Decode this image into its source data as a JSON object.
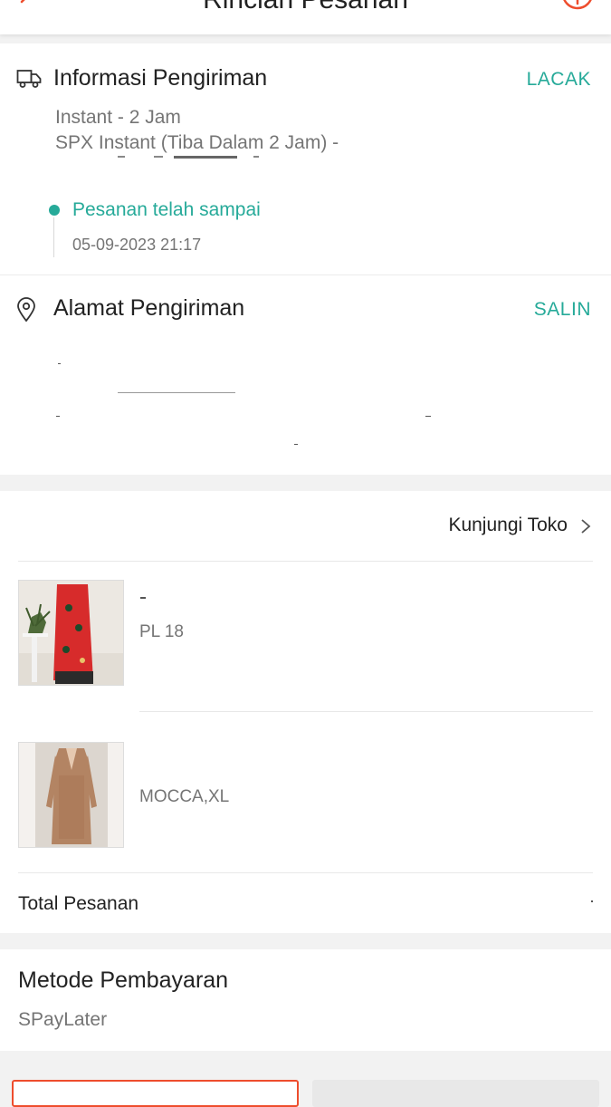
{
  "header": {
    "title": "Rincian Pesanan",
    "back_icon": "arrow-left-icon",
    "help_icon": "help-circle-icon",
    "accent_color": "#ee4d2d"
  },
  "shipping_info": {
    "icon": "truck-icon",
    "title": "Informasi Pengiriman",
    "action_label": "LACAK",
    "service": "Instant - 2 Jam",
    "courier": "SPX Instant (Tiba Dalam 2 Jam) -",
    "status": "Pesanan telah sampai",
    "status_time": "05-09-2023 21:17",
    "status_color": "#26aa99"
  },
  "shipping_address": {
    "icon": "location-pin-icon",
    "title": "Alamat Pengiriman",
    "action_label": "SALIN"
  },
  "shop": {
    "visit_label": "Kunjungi Toko",
    "visit_icon": "chevron-right-icon",
    "items": [
      {
        "variant": "PL 18",
        "image": "red-batik-skirt-product-image"
      },
      {
        "variant": "MOCCA,XL",
        "image": "mocca-lace-dress-product-image"
      }
    ],
    "total_label": "Total Pesanan"
  },
  "payment": {
    "title": "Metode Pembayaran",
    "value": "SPayLater"
  }
}
